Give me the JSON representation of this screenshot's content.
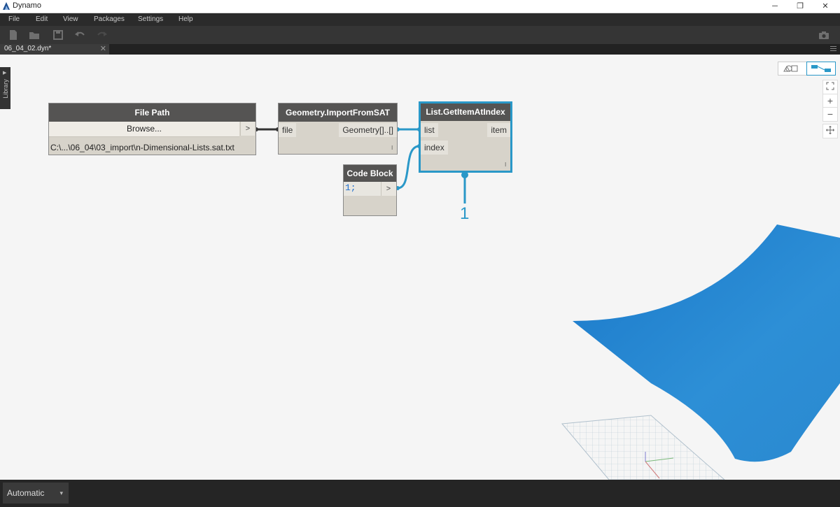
{
  "window": {
    "title": "Dynamo",
    "minimize_glyph": "─",
    "restore_glyph": "❐",
    "close_glyph": "✕"
  },
  "menu": [
    "File",
    "Edit",
    "View",
    "Packages",
    "Settings",
    "Help"
  ],
  "toolbar": {
    "new": "new-file-icon",
    "open": "open-file-icon",
    "save": "save-icon",
    "undo": "undo-icon",
    "redo": "redo-icon",
    "screenshot": "camera-icon"
  },
  "tab": {
    "label": "06_04_02.dyn*",
    "close_glyph": "✕"
  },
  "library": {
    "label": "Library"
  },
  "nodes": {
    "file_path": {
      "title": "File Path",
      "browse_label": "Browse...",
      "arrow": ">",
      "value": "C:\\...\\06_04\\03_import\\n-Dimensional-Lists.sat.txt"
    },
    "import_sat": {
      "title": "Geometry.ImportFromSAT",
      "input": "file",
      "output": "Geometry[]..[]",
      "lacing": "l"
    },
    "get_item": {
      "title": "List.GetItemAtIndex",
      "inputs": [
        "list",
        "index"
      ],
      "output": "item",
      "lacing": "l",
      "watch_value": "1"
    },
    "code_block": {
      "title": "Code Block",
      "code": "1;",
      "arrow": ">"
    }
  },
  "zoom": {
    "fit": "fit-view-icon",
    "zoom_in": "+",
    "zoom_out": "−",
    "pan": "pan-icon"
  },
  "view_toggle": {
    "geometry": "geometry-view-icon",
    "graph": "graph-view-icon"
  },
  "status": {
    "run_mode": "Automatic",
    "caret": "▾"
  },
  "colors": {
    "accent": "#2a98c8",
    "surface": "#2d8fd6",
    "node_header": "#555453",
    "node_body": "#d7d3ca"
  }
}
